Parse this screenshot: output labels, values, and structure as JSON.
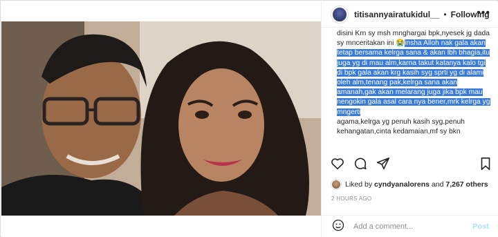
{
  "header": {
    "username": "titisannyairatukidul__",
    "separator": "•",
    "follow_label": "Following",
    "more_label": "•••"
  },
  "caption": {
    "plain_1": "disini Krn sy msh mnghargai bpk,nyesek jg dada sy mnceritakan ini 😭",
    "highlighted": "insha Alloh nak gala akan tetap bersama kelrga sana & akan lbh bhagia,itu juga yg di mau alm,karna takut katanya kalo tgi di bpk gala akan krg kasih syg sprti yg di alami oleh alm,tenang pak,kelrga sana akan amanah,gak akan melarang juga jika bpk mau nengokin gala asal cara nya bener,mrk kelrga yg mngerti",
    "plain_2": "agama,kelrga yg penuh kasih syg,penuh kehangatan,cinta kedamaian,mf sy bkn"
  },
  "actions": {
    "icons": [
      "heart-icon",
      "comment-icon",
      "share-icon",
      "bookmark-icon"
    ]
  },
  "likes": {
    "prefix": "Liked by ",
    "user": "cyndyanalorens",
    "middle": " and ",
    "others": "7,267 others"
  },
  "timestamp": "2 HOURS AGO",
  "comment": {
    "placeholder": "Add a comment...",
    "post_label": "Post"
  },
  "colors": {
    "highlight": "#3b7bd8",
    "post_disabled": "#b2dffc",
    "border": "#efefef"
  }
}
